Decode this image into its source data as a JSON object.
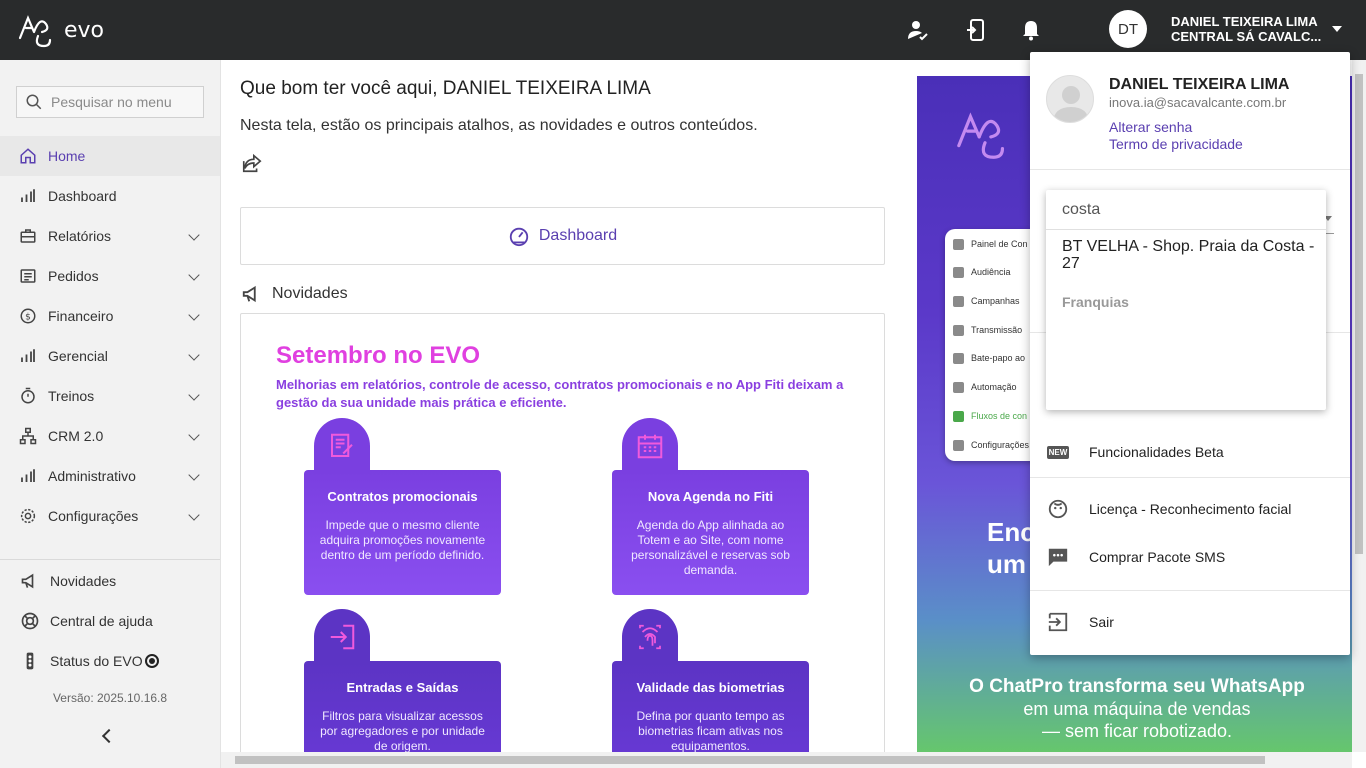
{
  "app": {
    "logo_text": "evo"
  },
  "topbar": {
    "avatar_initials": "DT",
    "user_name": "DANIEL TEIXEIRA LIMA",
    "unit_name": "CENTRAL SÁ CAVALC..."
  },
  "sidebar": {
    "search_placeholder": "Pesquisar no menu",
    "items": [
      {
        "label": "Home",
        "icon": "home-icon",
        "expandable": false,
        "active": true
      },
      {
        "label": "Dashboard",
        "icon": "bar-chart-icon",
        "expandable": false
      },
      {
        "label": "Relatórios",
        "icon": "briefcase-icon",
        "expandable": true
      },
      {
        "label": "Pedidos",
        "icon": "cart-icon",
        "expandable": true
      },
      {
        "label": "Financeiro",
        "icon": "dollar-icon",
        "expandable": true
      },
      {
        "label": "Gerencial",
        "icon": "bar-chart-icon",
        "expandable": true
      },
      {
        "label": "Treinos",
        "icon": "timer-icon",
        "expandable": true
      },
      {
        "label": "CRM 2.0",
        "icon": "network-icon",
        "expandable": true
      },
      {
        "label": "Administrativo",
        "icon": "bar-chart-icon",
        "expandable": true
      },
      {
        "label": "Configurações",
        "icon": "gear-icon",
        "expandable": true
      }
    ],
    "bottom": {
      "novidades": "Novidades",
      "help": "Central de ajuda",
      "status": "Status do EVO"
    },
    "version": "Versão: 2025.10.16.8"
  },
  "main": {
    "welcome": "Que bom ter você aqui, DANIEL TEIXEIRA LIMA",
    "subtitle": "Nesta tela, estão os principais atalhos, as novidades e outros conteúdos.",
    "dashboard_card": "Dashboard",
    "novidades_title": "Novidades",
    "news": {
      "title": "Setembro no EVO",
      "description": "Melhorias em relatórios, controle de acesso, contratos promocionais e no App Fiti deixam a gestão da sua unidade mais prática e eficiente.",
      "features": [
        {
          "title": "Contratos promocionais",
          "text": "Impede que o mesmo cliente adquira promoções novamente dentro de um período definido."
        },
        {
          "title": "Nova Agenda no Fiti",
          "text": "Agenda do App alinhada ao Totem e ao Site, com nome personalizável e reservas sob demanda."
        },
        {
          "title": "Entradas e Saídas",
          "text": "Filtros para visualizar acessos por agregadores e por unidade de origem."
        },
        {
          "title": "Validade das biometrias",
          "text": "Defina por quanto tempo as biometrias ficam ativas nos equipamentos."
        }
      ]
    },
    "promo": {
      "phone_items": [
        "Painel de Con",
        "Audiência",
        "Campanhas",
        "Transmissão",
        "Bate-papo ao",
        "Automação",
        "Fluxos de con",
        "Configurações"
      ],
      "big_text_1": "Enc",
      "big_text_2": "um",
      "line1": "O ChatPro transforma seu WhatsApp",
      "line2": "em uma máquina de vendas",
      "line3": "— sem ficar robotizado."
    }
  },
  "dropdown": {
    "name": "DANIEL TEIXEIRA LIMA",
    "email": "inova.ia@sacavalcante.com.br",
    "change_password": "Alterar senha",
    "privacy": "Termo de privacidade",
    "beta": "Funcionalidades Beta",
    "license": "Licença - Reconhecimento facial",
    "sms": "Comprar Pacote SMS",
    "logout": "Sair",
    "new_badge": "NEW"
  },
  "unit_search": {
    "query": "costa",
    "option": "BT VELHA - Shop. Praia da Costa - 27",
    "group": "Franquias"
  }
}
